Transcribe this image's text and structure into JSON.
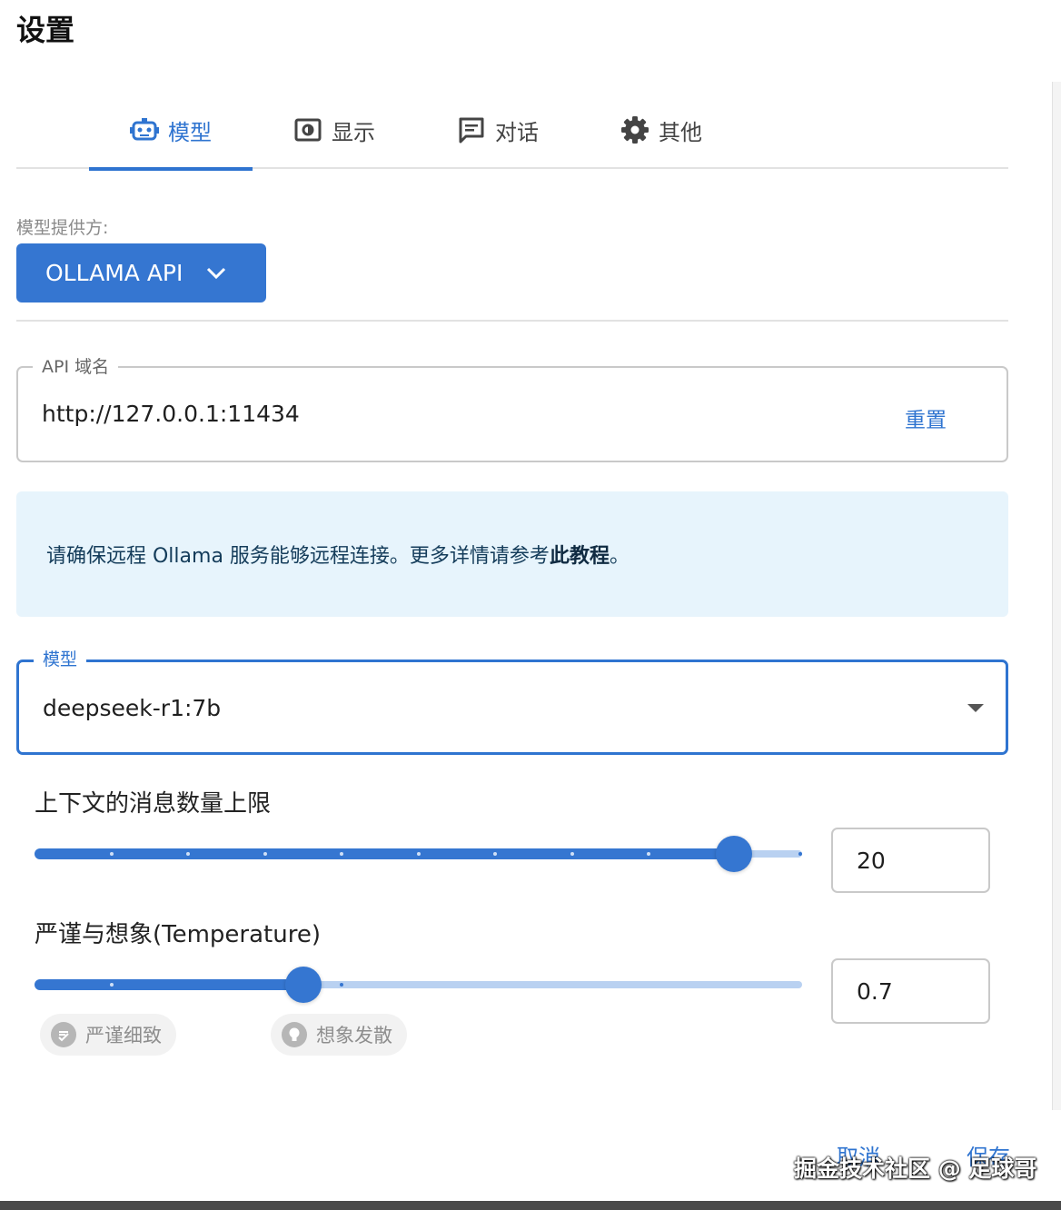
{
  "dialog": {
    "title": "设置"
  },
  "tabs": [
    {
      "label": "模型",
      "icon": "robot-icon",
      "active": true
    },
    {
      "label": "显示",
      "icon": "display-icon",
      "active": false
    },
    {
      "label": "对话",
      "icon": "chat-icon",
      "active": false
    },
    {
      "label": "其他",
      "icon": "gear-icon",
      "active": false
    }
  ],
  "model_tab": {
    "provider_label": "模型提供方:",
    "provider_value": "OLLAMA API",
    "api_host": {
      "label": "API 域名",
      "value": "http://127.0.0.1:11434",
      "reset_label": "重置"
    },
    "info": {
      "text": "请确保远程 Ollama 服务能够远程连接。更多详情请参考",
      "link": "此教程",
      "suffix": "。"
    },
    "model_select": {
      "label": "模型",
      "value": "deepseek-r1:7b"
    },
    "context_limit": {
      "title": "上下文的消息数量上限",
      "value": "20",
      "fill_fraction": 0.911,
      "mark_count": 10
    },
    "temperature": {
      "title": "严谨与想象(Temperature)",
      "value": "0.7",
      "fill_fraction": 0.35,
      "chip_precise": "严谨细致",
      "chip_creative": "想象发散"
    }
  },
  "footer": {
    "cancel_label": "取消",
    "save_label": "保存"
  },
  "watermark": "掘金技术社区 @ 足球哥",
  "colors": {
    "accent": "#3576d1",
    "info_bg": "#e7f4fc"
  }
}
